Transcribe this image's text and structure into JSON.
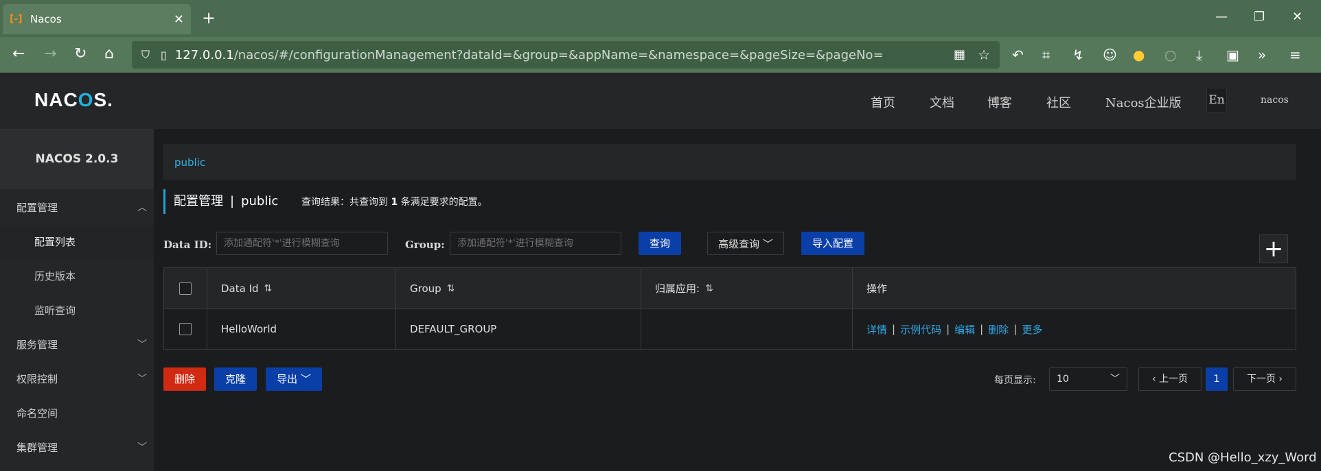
{
  "browser": {
    "tab_title": "Nacos",
    "tab_favicon": "[-]",
    "url_host": "127.0.0.1",
    "url_path": "/nacos/#/configurationManagement?dataId=&group=&appName=&namespace=&pageSize=&pageNo="
  },
  "header": {
    "logo_prefix": "NAC",
    "logo_o": "O",
    "logo_suffix": "S.",
    "nav": [
      "首页",
      "文档",
      "博客",
      "社区",
      "Nacos企业版"
    ],
    "lang": "En",
    "user": "nacos"
  },
  "sidebar": {
    "brand": "NACOS 2.0.3",
    "items": [
      {
        "label": "配置管理",
        "expanded": true
      },
      {
        "label": "配置列表"
      },
      {
        "label": "历史版本"
      },
      {
        "label": "监听查询"
      },
      {
        "label": "服务管理"
      },
      {
        "label": "权限控制"
      },
      {
        "label": "命名空间"
      },
      {
        "label": "集群管理"
      }
    ]
  },
  "main": {
    "namespace": "public",
    "title": "配置管理",
    "title_sep": "|",
    "title_ns": "public",
    "result_prefix": "查询结果：共查询到",
    "result_count": "1",
    "result_suffix": "条满足要求的配置。",
    "filters": {
      "dataid_label": "Data ID:",
      "dataid_placeholder": "添加通配符'*'进行模糊查询",
      "group_label": "Group:",
      "group_placeholder": "添加通配符'*'进行模糊查询",
      "query_button": "查询",
      "advanced_button": "高级查询",
      "import_button": "导入配置"
    },
    "table": {
      "columns": [
        "Data Id",
        "Group",
        "归属应用:",
        "操作"
      ],
      "rows": [
        {
          "data_id": "HelloWorld",
          "group": "DEFAULT_GROUP",
          "app": "",
          "actions": [
            "详情",
            "示例代码",
            "编辑",
            "删除",
            "更多"
          ]
        }
      ],
      "action_sep": "|"
    },
    "bottom": {
      "delete_button": "删除",
      "clone_button": "克隆",
      "export_button": "导出",
      "pagesize_label": "每页显示:",
      "pagesize_value": "10",
      "prev_button": "上一页",
      "page_current": "1",
      "next_button": "下一页"
    }
  },
  "watermark": "CSDN @Hello_xzy_Word"
}
